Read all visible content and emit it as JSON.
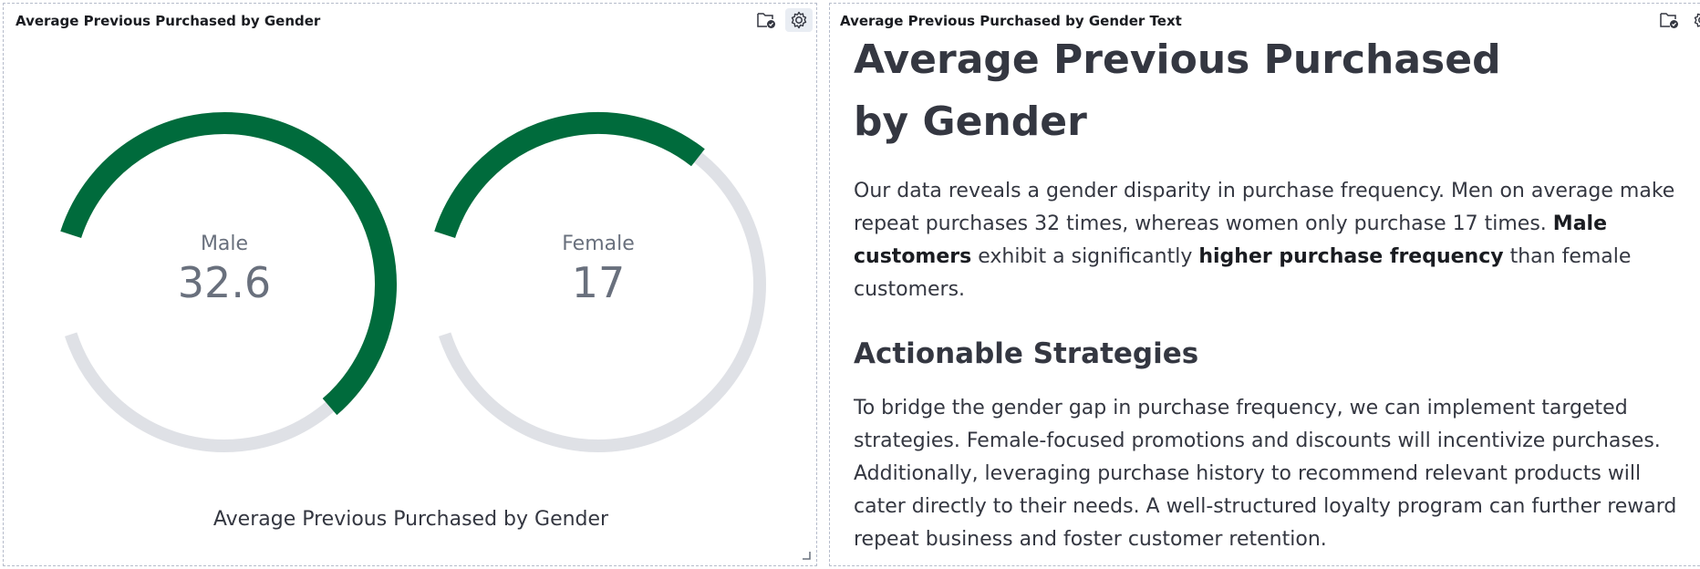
{
  "left_panel": {
    "title": "Average Previous Purchased by Gender",
    "caption": "Average Previous Purchased by Gender",
    "icons": [
      "folder-check-icon",
      "gear-icon"
    ]
  },
  "chart_data": {
    "type": "gauge",
    "title": "Average Previous Purchased by Gender",
    "categories": [
      "Male",
      "Female"
    ],
    "values": [
      32.6,
      17
    ],
    "value_labels": [
      "32.6",
      "17"
    ],
    "range": [
      0,
      50
    ],
    "colors": {
      "fill": "#006b3c",
      "track": "#dfe1e6",
      "label": "#69707d"
    }
  },
  "right_panel": {
    "title": "Average Previous Purchased by Gender Text",
    "icons": [
      "folder-check-icon",
      "gear-icon"
    ],
    "heading": "Average Previous Purchased by Gender",
    "intro_1": "Our data reveals a gender disparity in purchase frequency. Men on average make repeat purchases 32 times, whereas women only purchase 17 times. ",
    "intro_bold_1": "Male customers",
    "intro_2": " exhibit a significantly ",
    "intro_bold_2": "higher purchase frequency",
    "intro_3": " than female customers.",
    "subheading": "Actionable Strategies",
    "strategy": "To bridge the gender gap in purchase frequency, we can implement targeted strategies. Female-focused promotions and discounts will incentivize purchases. Additionally, leveraging purchase history to recommend relevant products will cater directly to their needs. A well-structured loyalty program can further reward repeat business and foster customer retention."
  }
}
